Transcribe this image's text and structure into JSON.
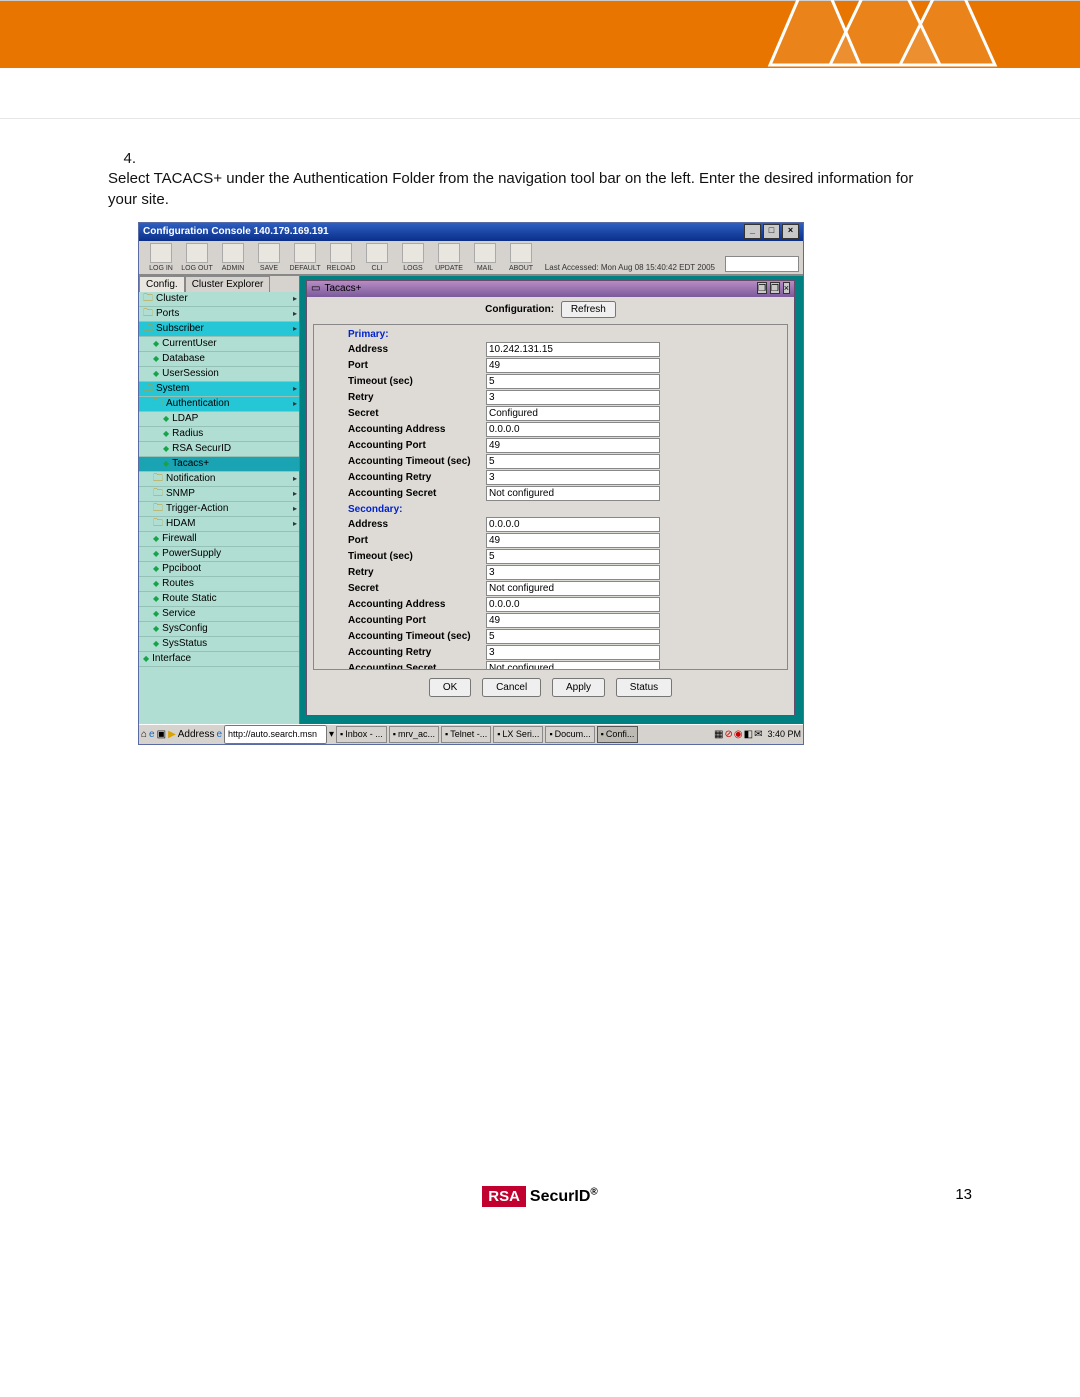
{
  "step": {
    "num": "4.",
    "text": "Select TACACS+ under the Authentication Folder from the navigation tool bar on the left. Enter the desired information for your site."
  },
  "console": {
    "title": "Configuration Console 140.179.169.191",
    "last_accessed": "Last Accessed: Mon Aug 08 15:40:42 EDT 2005",
    "toolbar": [
      "LOG IN",
      "LOG OUT",
      "ADMIN",
      "SAVE",
      "DEFAULT",
      "RELOAD",
      "CLI",
      "LOGS",
      "UPDATE",
      "MAIL",
      "ABOUT"
    ],
    "nav_tabs": {
      "left": "Config.",
      "right": "Cluster Explorer"
    },
    "tree": [
      {
        "lvl": 1,
        "type": "fold",
        "label": "Cluster",
        "arrow": true
      },
      {
        "lvl": 1,
        "type": "fold",
        "label": "Ports",
        "arrow": true
      },
      {
        "lvl": 1,
        "type": "fold",
        "label": "Subscriber",
        "hl": true,
        "arrow": true
      },
      {
        "lvl": 2,
        "type": "leaf",
        "label": "CurrentUser"
      },
      {
        "lvl": 2,
        "type": "leaf",
        "label": "Database"
      },
      {
        "lvl": 2,
        "type": "leaf",
        "label": "UserSession"
      },
      {
        "lvl": 1,
        "type": "fold",
        "label": "System",
        "hl": true,
        "arrow": true
      },
      {
        "lvl": 2,
        "type": "fold",
        "label": "Authentication",
        "hl": true,
        "arrow": true
      },
      {
        "lvl": 3,
        "type": "leaf",
        "label": "LDAP"
      },
      {
        "lvl": 3,
        "type": "leaf",
        "label": "Radius"
      },
      {
        "lvl": 3,
        "type": "leaf",
        "label": "RSA SecurID"
      },
      {
        "lvl": 3,
        "type": "leaf",
        "label": "Tacacs+",
        "sel": true
      },
      {
        "lvl": 2,
        "type": "fold",
        "label": "Notification",
        "arrow": true
      },
      {
        "lvl": 2,
        "type": "fold",
        "label": "SNMP",
        "arrow": true
      },
      {
        "lvl": 2,
        "type": "fold",
        "label": "Trigger-Action",
        "arrow": true
      },
      {
        "lvl": 2,
        "type": "fold",
        "label": "HDAM",
        "arrow": true
      },
      {
        "lvl": 2,
        "type": "leaf",
        "label": "Firewall"
      },
      {
        "lvl": 2,
        "type": "leaf",
        "label": "PowerSupply"
      },
      {
        "lvl": 2,
        "type": "leaf",
        "label": "Ppciboot"
      },
      {
        "lvl": 2,
        "type": "leaf",
        "label": "Routes"
      },
      {
        "lvl": 2,
        "type": "leaf",
        "label": "Route Static"
      },
      {
        "lvl": 2,
        "type": "leaf",
        "label": "Service"
      },
      {
        "lvl": 2,
        "type": "leaf",
        "label": "SysConfig"
      },
      {
        "lvl": 2,
        "type": "leaf",
        "label": "SysStatus"
      },
      {
        "lvl": 1,
        "type": "leaf",
        "label": "Interface"
      }
    ],
    "panel": {
      "title": "Tacacs+",
      "conf_label": "Configuration:",
      "refresh": "Refresh",
      "primary_hdr": "Primary:",
      "secondary_hdr": "Secondary:",
      "primary": {
        "Address": "10.242.131.15",
        "Port": "49",
        "Timeout (sec)": "5",
        "Retry": "3",
        "Secret": "Configured",
        "Accounting Address": "0.0.0.0",
        "Accounting Port": "49",
        "Accounting Timeout (sec)": "5",
        "Accounting Retry": "3",
        "Accounting Secret": "Not configured"
      },
      "secondary": {
        "Address": "0.0.0.0",
        "Port": "49",
        "Timeout (sec)": "5",
        "Retry": "3",
        "Secret": "Not configured",
        "Accounting Address": "0.0.0.0",
        "Accounting Port": "49",
        "Accounting Timeout (sec)": "5",
        "Accounting Retry": "3",
        "Accounting Secret": "Not configured"
      },
      "buttons": {
        "ok": "OK",
        "cancel": "Cancel",
        "apply": "Apply",
        "status": "Status"
      }
    },
    "taskbar": {
      "address_label": "Address",
      "address_value": "http://auto.search.msn",
      "apps": [
        "Inbox - ...",
        "mrv_ac...",
        "Telnet -...",
        "LX Seri...",
        "Docum...",
        "Confi..."
      ],
      "clock": "3:40 PM"
    }
  },
  "footer": {
    "rsa": "RSA",
    "product": "SecurID",
    "reg": "®",
    "page": "13"
  }
}
